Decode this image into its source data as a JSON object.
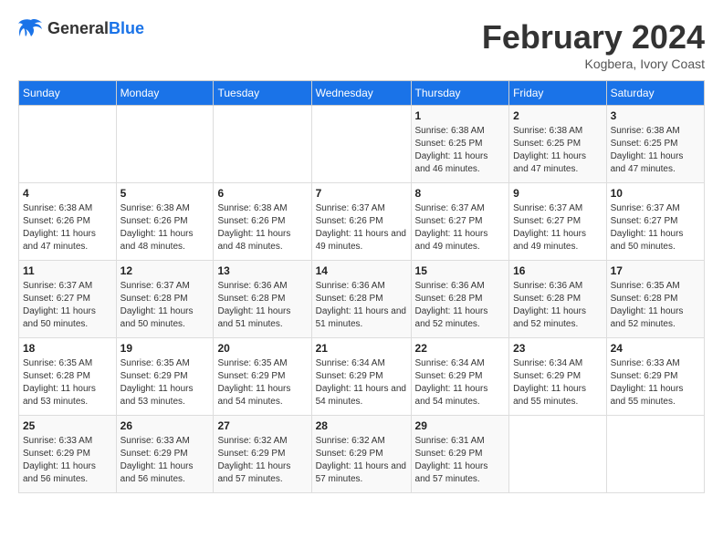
{
  "header": {
    "logo_general": "General",
    "logo_blue": "Blue",
    "month_year": "February 2024",
    "location": "Kogbera, Ivory Coast"
  },
  "weekdays": [
    "Sunday",
    "Monday",
    "Tuesday",
    "Wednesday",
    "Thursday",
    "Friday",
    "Saturday"
  ],
  "weeks": [
    [
      {
        "day": "",
        "info": ""
      },
      {
        "day": "",
        "info": ""
      },
      {
        "day": "",
        "info": ""
      },
      {
        "day": "",
        "info": ""
      },
      {
        "day": "1",
        "info": "Sunrise: 6:38 AM\nSunset: 6:25 PM\nDaylight: 11 hours\nand 46 minutes."
      },
      {
        "day": "2",
        "info": "Sunrise: 6:38 AM\nSunset: 6:25 PM\nDaylight: 11 hours\nand 47 minutes."
      },
      {
        "day": "3",
        "info": "Sunrise: 6:38 AM\nSunset: 6:25 PM\nDaylight: 11 hours\nand 47 minutes."
      }
    ],
    [
      {
        "day": "4",
        "info": "Sunrise: 6:38 AM\nSunset: 6:26 PM\nDaylight: 11 hours\nand 47 minutes."
      },
      {
        "day": "5",
        "info": "Sunrise: 6:38 AM\nSunset: 6:26 PM\nDaylight: 11 hours\nand 48 minutes."
      },
      {
        "day": "6",
        "info": "Sunrise: 6:38 AM\nSunset: 6:26 PM\nDaylight: 11 hours\nand 48 minutes."
      },
      {
        "day": "7",
        "info": "Sunrise: 6:37 AM\nSunset: 6:26 PM\nDaylight: 11 hours\nand 49 minutes."
      },
      {
        "day": "8",
        "info": "Sunrise: 6:37 AM\nSunset: 6:27 PM\nDaylight: 11 hours\nand 49 minutes."
      },
      {
        "day": "9",
        "info": "Sunrise: 6:37 AM\nSunset: 6:27 PM\nDaylight: 11 hours\nand 49 minutes."
      },
      {
        "day": "10",
        "info": "Sunrise: 6:37 AM\nSunset: 6:27 PM\nDaylight: 11 hours\nand 50 minutes."
      }
    ],
    [
      {
        "day": "11",
        "info": "Sunrise: 6:37 AM\nSunset: 6:27 PM\nDaylight: 11 hours\nand 50 minutes."
      },
      {
        "day": "12",
        "info": "Sunrise: 6:37 AM\nSunset: 6:28 PM\nDaylight: 11 hours\nand 50 minutes."
      },
      {
        "day": "13",
        "info": "Sunrise: 6:36 AM\nSunset: 6:28 PM\nDaylight: 11 hours\nand 51 minutes."
      },
      {
        "day": "14",
        "info": "Sunrise: 6:36 AM\nSunset: 6:28 PM\nDaylight: 11 hours\nand 51 minutes."
      },
      {
        "day": "15",
        "info": "Sunrise: 6:36 AM\nSunset: 6:28 PM\nDaylight: 11 hours\nand 52 minutes."
      },
      {
        "day": "16",
        "info": "Sunrise: 6:36 AM\nSunset: 6:28 PM\nDaylight: 11 hours\nand 52 minutes."
      },
      {
        "day": "17",
        "info": "Sunrise: 6:35 AM\nSunset: 6:28 PM\nDaylight: 11 hours\nand 52 minutes."
      }
    ],
    [
      {
        "day": "18",
        "info": "Sunrise: 6:35 AM\nSunset: 6:28 PM\nDaylight: 11 hours\nand 53 minutes."
      },
      {
        "day": "19",
        "info": "Sunrise: 6:35 AM\nSunset: 6:29 PM\nDaylight: 11 hours\nand 53 minutes."
      },
      {
        "day": "20",
        "info": "Sunrise: 6:35 AM\nSunset: 6:29 PM\nDaylight: 11 hours\nand 54 minutes."
      },
      {
        "day": "21",
        "info": "Sunrise: 6:34 AM\nSunset: 6:29 PM\nDaylight: 11 hours\nand 54 minutes."
      },
      {
        "day": "22",
        "info": "Sunrise: 6:34 AM\nSunset: 6:29 PM\nDaylight: 11 hours\nand 54 minutes."
      },
      {
        "day": "23",
        "info": "Sunrise: 6:34 AM\nSunset: 6:29 PM\nDaylight: 11 hours\nand 55 minutes."
      },
      {
        "day": "24",
        "info": "Sunrise: 6:33 AM\nSunset: 6:29 PM\nDaylight: 11 hours\nand 55 minutes."
      }
    ],
    [
      {
        "day": "25",
        "info": "Sunrise: 6:33 AM\nSunset: 6:29 PM\nDaylight: 11 hours\nand 56 minutes."
      },
      {
        "day": "26",
        "info": "Sunrise: 6:33 AM\nSunset: 6:29 PM\nDaylight: 11 hours\nand 56 minutes."
      },
      {
        "day": "27",
        "info": "Sunrise: 6:32 AM\nSunset: 6:29 PM\nDaylight: 11 hours\nand 57 minutes."
      },
      {
        "day": "28",
        "info": "Sunrise: 6:32 AM\nSunset: 6:29 PM\nDaylight: 11 hours\nand 57 minutes."
      },
      {
        "day": "29",
        "info": "Sunrise: 6:31 AM\nSunset: 6:29 PM\nDaylight: 11 hours\nand 57 minutes."
      },
      {
        "day": "",
        "info": ""
      },
      {
        "day": "",
        "info": ""
      }
    ]
  ]
}
